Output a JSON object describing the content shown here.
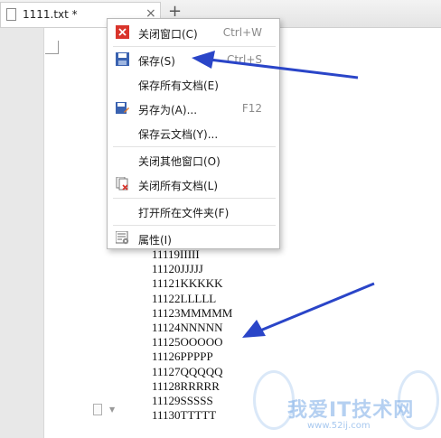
{
  "tab": {
    "title": "1111.txt *",
    "close_glyph": "×",
    "add_glyph": "+"
  },
  "menu": {
    "items": [
      {
        "label": "关闭窗口(C)",
        "shortcut": "Ctrl+W",
        "icon": "close-window-icon"
      },
      {
        "label": "保存(S)",
        "shortcut": "Ctrl+S",
        "icon": "save-icon"
      },
      {
        "label": "保存所有文档(E)",
        "shortcut": "",
        "icon": ""
      },
      {
        "label": "另存为(A)...",
        "shortcut": "F12",
        "icon": "save-as-icon"
      },
      {
        "label": "保存云文档(Y)...",
        "shortcut": "",
        "icon": ""
      },
      {
        "label": "关闭其他窗口(O)",
        "shortcut": "",
        "icon": ""
      },
      {
        "label": "关闭所有文档(L)",
        "shortcut": "",
        "icon": "close-all-icon"
      },
      {
        "label": "打开所在文件夹(F)",
        "shortcut": "",
        "icon": ""
      },
      {
        "label": "属性(I)",
        "shortcut": "",
        "icon": "properties-icon"
      }
    ]
  },
  "document": {
    "lines": [
      "11119IIIII",
      "11120JJJJJ",
      "11121KKKKK",
      "11122LLLLL",
      "11123MMMMM",
      "11124NNNNN",
      "11125OOOOO",
      "11126PPPPP",
      "11127QQQQQ",
      "11128RRRRR",
      "11129SSSSS",
      "11130TTTTT"
    ]
  },
  "watermark": {
    "text": "我爱IT技术网",
    "url": "www.52ij.com"
  },
  "colors": {
    "arrow": "#2a45c8",
    "close_icon_red": "#d9342b",
    "save_icon_blue": "#3a62b0"
  }
}
